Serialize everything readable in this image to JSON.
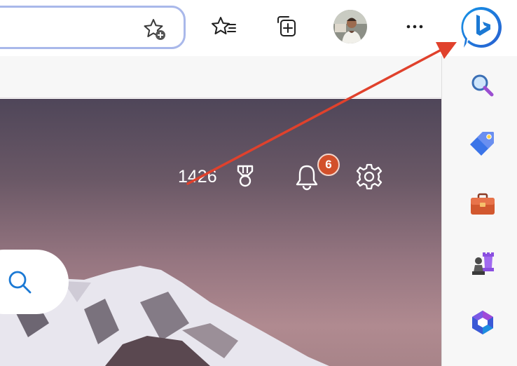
{
  "toolbar": {
    "address_bar": {
      "icon": "add-to-favorites-icon"
    },
    "buttons": [
      {
        "name": "favorites-button",
        "icon": "favorites-list-icon"
      },
      {
        "name": "collections-button",
        "icon": "collections-icon"
      },
      {
        "name": "profile-avatar",
        "icon": "profile-photo"
      },
      {
        "name": "more-options-button",
        "icon": "ellipsis-icon"
      },
      {
        "name": "bing-chat-button",
        "icon": "bing-icon"
      }
    ]
  },
  "hero": {
    "rewards_points": "1426",
    "notification_count": "6",
    "icons": [
      "rewards-trophy-icon",
      "notifications-bell-icon",
      "settings-gear-icon",
      "search-icon"
    ]
  },
  "sidebar": {
    "items": [
      {
        "name": "search",
        "icon": "magnifier-icon"
      },
      {
        "name": "shopping",
        "icon": "price-tag-icon"
      },
      {
        "name": "tools",
        "icon": "toolbox-icon"
      },
      {
        "name": "games",
        "icon": "chess-pieces-icon"
      },
      {
        "name": "microsoft-365",
        "icon": "microsoft-365-icon"
      }
    ]
  },
  "colors": {
    "accent_blue": "#1b79d4",
    "address_border": "#a9b8ea",
    "badge": "#d2502b",
    "annotation_arrow": "#e0412c",
    "hero_top": "#4f4659",
    "hero_bottom": "#b08a90"
  }
}
